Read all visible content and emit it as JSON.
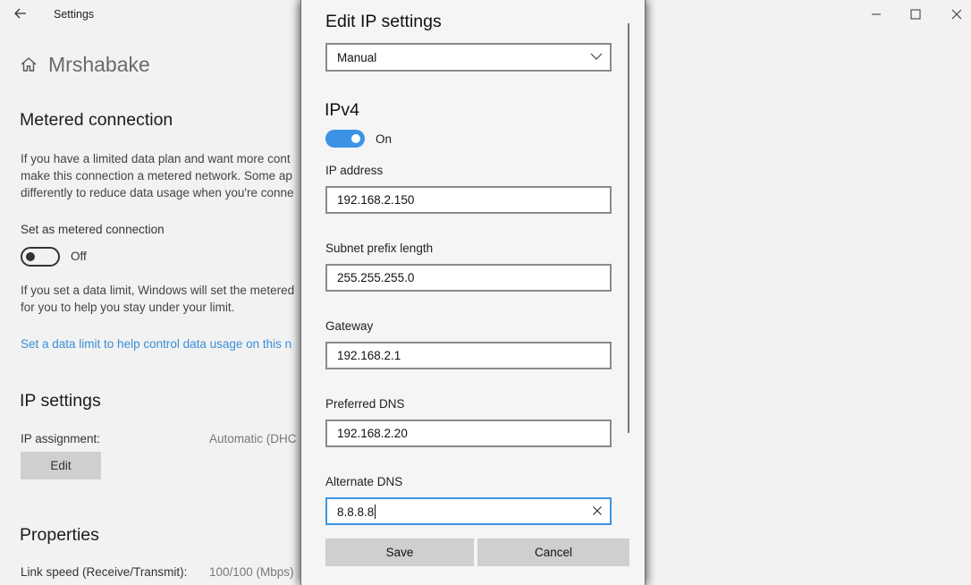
{
  "window": {
    "title": "Settings"
  },
  "page": {
    "title": "Mrshabake",
    "metered": {
      "heading": "Metered connection",
      "description_lines": [
        "If you have a limited data plan and want more cont",
        "make this connection a metered network. Some ap",
        "differently to reduce data usage when you're conne"
      ],
      "toggle_label": "Set as metered connection",
      "toggle_state": "Off",
      "limit_lines": [
        "If you set a data limit, Windows will set the metered",
        "for you to help you stay under your limit."
      ],
      "link": "Set a data limit to help control data usage on this n"
    },
    "ip_settings": {
      "heading": "IP settings",
      "assignment_label": "IP assignment:",
      "assignment_value": "Automatic (DHC",
      "edit_label": "Edit"
    },
    "properties": {
      "heading": "Properties",
      "link_speed_label": "Link speed (Receive/Transmit):",
      "link_speed_value": "100/100 (Mbps)"
    }
  },
  "dialog": {
    "title": "Edit IP settings",
    "mode_selected": "Manual",
    "ipv4": {
      "heading": "IPv4",
      "toggle_state": "On",
      "ip_address_label": "IP address",
      "ip_address": "192.168.2.150",
      "subnet_label": "Subnet prefix length",
      "subnet": "255.255.255.0",
      "gateway_label": "Gateway",
      "gateway": "192.168.2.1",
      "preferred_dns_label": "Preferred DNS",
      "preferred_dns": "192.168.2.20",
      "alternate_dns_label": "Alternate DNS",
      "alternate_dns": "8.8.8.8"
    },
    "save_label": "Save",
    "cancel_label": "Cancel"
  },
  "colors": {
    "accent": "#3c93e6",
    "link": "#3a8ed8",
    "button": "#cfcfcf"
  },
  "icons": [
    "back-arrow-icon",
    "home-icon",
    "minimize-icon",
    "maximize-icon",
    "close-icon",
    "chevron-down-icon",
    "clear-icon"
  ]
}
